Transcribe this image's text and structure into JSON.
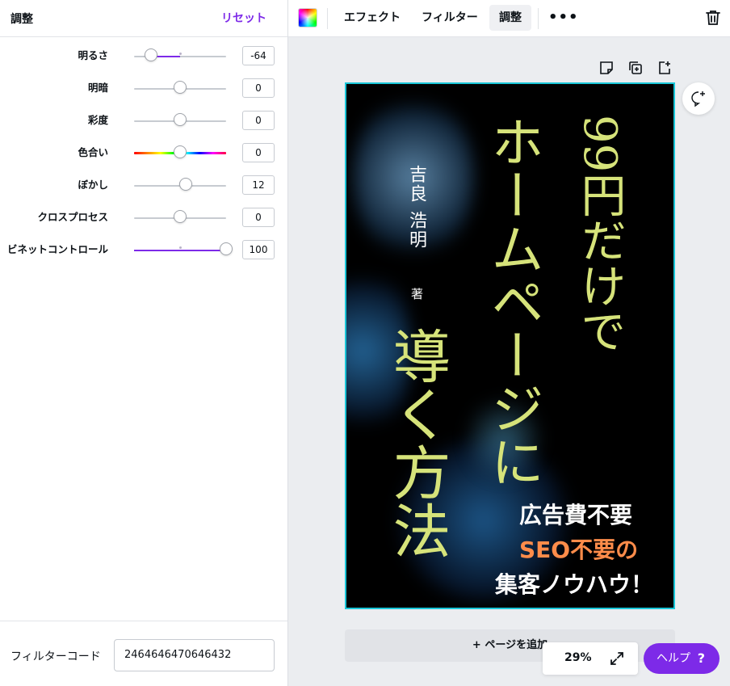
{
  "panel": {
    "title": "調整",
    "reset_label": "リセット",
    "sliders": [
      {
        "label": "明るさ",
        "value": "-64",
        "fraction": 0.18,
        "fill_from": 0.18,
        "fill_to": 0.5
      },
      {
        "label": "明暗",
        "value": "0",
        "fraction": 0.5
      },
      {
        "label": "彩度",
        "value": "0",
        "fraction": 0.5
      },
      {
        "label": "色合い",
        "value": "0",
        "fraction": 0.5,
        "hue": true
      },
      {
        "label": "ぼかし",
        "value": "12",
        "fraction": 0.56
      },
      {
        "label": "クロスプロセス",
        "value": "0",
        "fraction": 0.5
      },
      {
        "label": "ビネットコントロール",
        "value": "100",
        "fraction": 1.0,
        "fill_from": 0.0,
        "fill_to": 1.0
      }
    ],
    "filter_code_label": "フィルターコード",
    "filter_code_value": "2464646470646432"
  },
  "toolbar": {
    "effects_label": "エフェクト",
    "filter_label": "フィルター",
    "adjust_label": "調整",
    "more_label": "•••"
  },
  "cover": {
    "title_top": "99円だけで",
    "title_mid": "ホームページに",
    "title_bottom": "導く方法",
    "author": "吉良 浩明",
    "author_suffix": "著",
    "copy1": "広告費不要",
    "copy2": "SEO不要の",
    "copy3": "集客ノウハウ！",
    "title_color": "#d6e37a",
    "copy_accent_color": "#ff8c4a"
  },
  "canvas": {
    "add_page_label": "+ ページを追加",
    "zoom": "29%",
    "help_label": "ヘルプ",
    "help_symbol": "?"
  },
  "colors": {
    "accent": "#7d2ae8",
    "selection": "#19c6d8"
  },
  "icons": [
    "notes-icon",
    "duplicate-page-icon",
    "add-page-icon",
    "trash-icon",
    "comment-add-icon",
    "expand-icon",
    "color-palette-icon"
  ]
}
